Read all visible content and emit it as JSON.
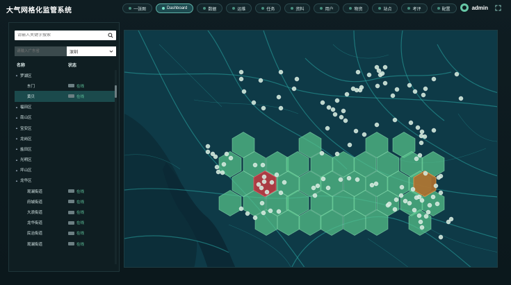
{
  "app": {
    "title": "大气网格化监管系统"
  },
  "nav": {
    "items": [
      {
        "label": "一张图",
        "active": false
      },
      {
        "label": "Dashboard",
        "active": true
      },
      {
        "label": "数据",
        "active": false
      },
      {
        "label": "运维",
        "active": false
      },
      {
        "label": "任务",
        "active": false
      },
      {
        "label": "资料",
        "active": false
      },
      {
        "label": "用户",
        "active": false
      },
      {
        "label": "物资",
        "active": false
      },
      {
        "label": "站点",
        "active": false
      },
      {
        "label": "考评",
        "active": false
      },
      {
        "label": "配置",
        "active": false
      }
    ]
  },
  "user": {
    "name": "admin"
  },
  "sidebar": {
    "search_placeholder": "请输入关键字搜索",
    "filter_placeholder": "请输入广东省",
    "city_select": "深圳",
    "col_name": "名称",
    "col_status": "状态",
    "tree": [
      {
        "label": "罗湖区",
        "level": 0,
        "status": ""
      },
      {
        "label": "东门",
        "level": 1,
        "status": "在线"
      },
      {
        "label": "黄贝",
        "level": 1,
        "status": "在线",
        "selected": true
      },
      {
        "label": "福田区",
        "level": 0,
        "status": ""
      },
      {
        "label": "南山区",
        "level": 0,
        "status": ""
      },
      {
        "label": "宝安区",
        "level": 0,
        "status": ""
      },
      {
        "label": "龙岗区",
        "level": 0,
        "status": ""
      },
      {
        "label": "盐田区",
        "level": 0,
        "status": ""
      },
      {
        "label": "光明区",
        "level": 0,
        "status": ""
      },
      {
        "label": "坪山区",
        "level": 0,
        "status": ""
      },
      {
        "label": "龙华区",
        "level": 0,
        "status": ""
      },
      {
        "label": "观澜街道",
        "level": 1,
        "status": "在线"
      },
      {
        "label": "府城街道",
        "level": 1,
        "status": "在线"
      },
      {
        "label": "大浪街道",
        "level": 1,
        "status": "在线"
      },
      {
        "label": "龙华街道",
        "level": 1,
        "status": "在线"
      },
      {
        "label": "民治街道",
        "level": 1,
        "status": "在线"
      },
      {
        "label": "观澜街道",
        "level": 1,
        "status": "在线"
      }
    ]
  },
  "map": {
    "colors": {
      "background": "#0e3a47",
      "hex_fill": "#57c48a",
      "hex_alert": "#b3343f",
      "hex_warning": "#b06f2c",
      "road": "#2aa7a4",
      "marker": "#cfe8da"
    }
  }
}
